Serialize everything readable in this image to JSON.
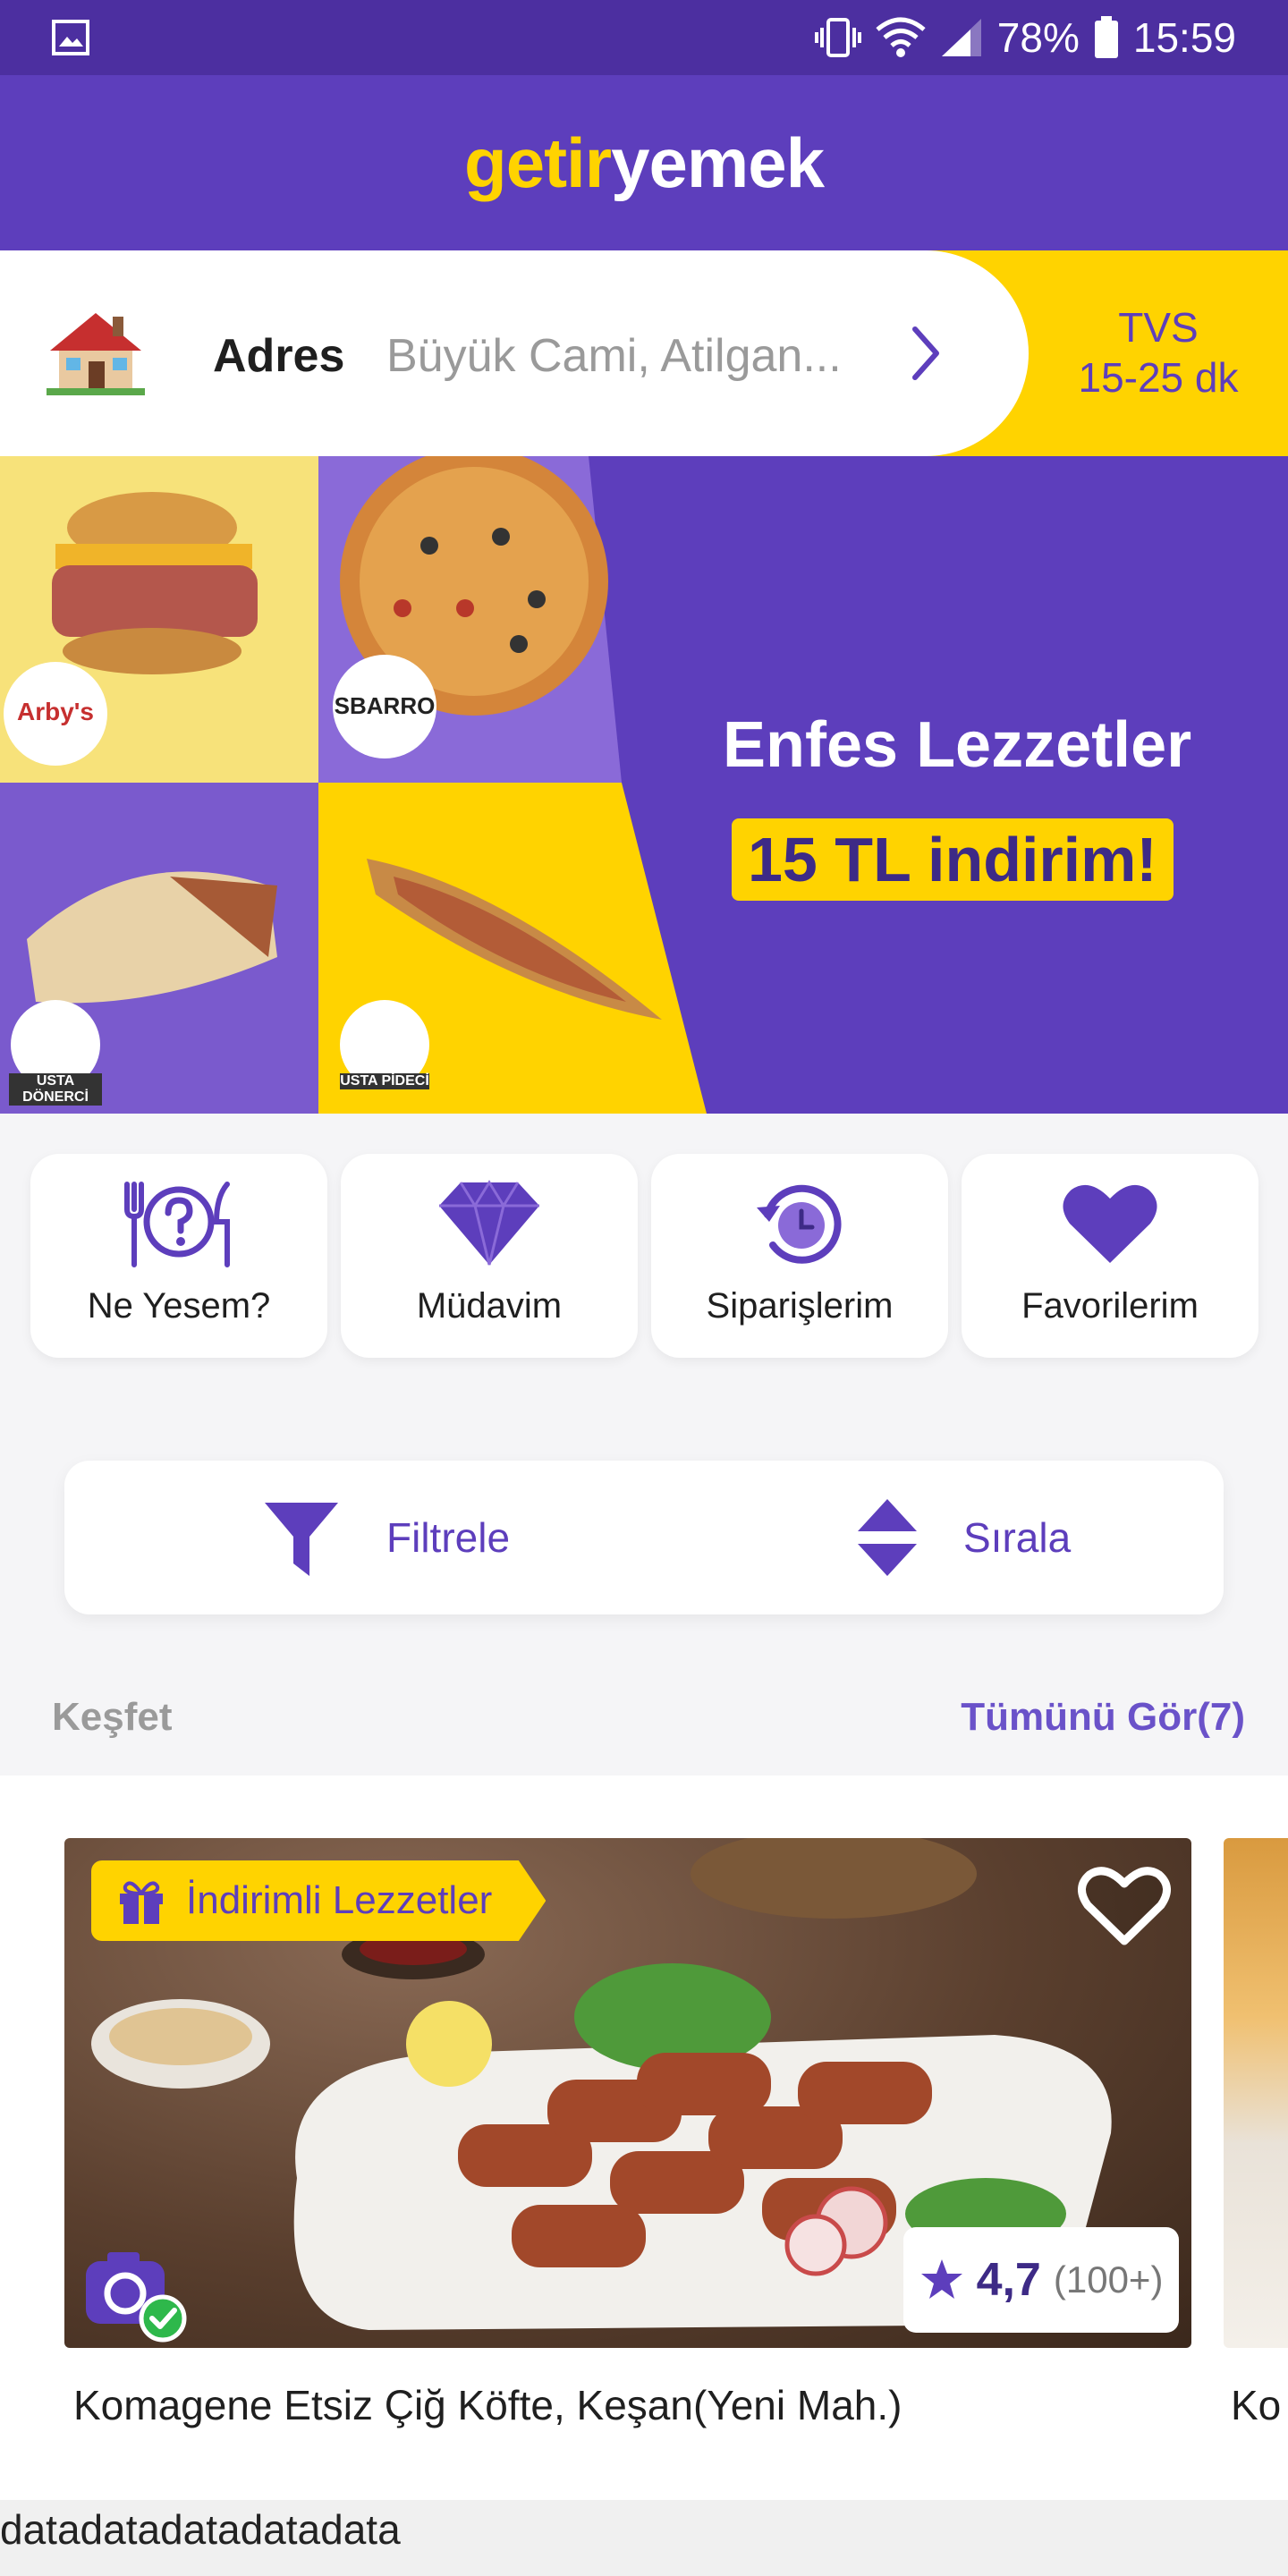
{
  "status_bar": {
    "battery": "78%",
    "time": "15:59"
  },
  "header": {
    "logo_part1": "getir",
    "logo_part2": "yemek"
  },
  "address": {
    "label": "Adres",
    "value": "Büyük Cami, Atilgan...",
    "eta_place": "TVS",
    "eta_time": "15-25 dk"
  },
  "banner": {
    "title": "Enfes Lezzetler",
    "subtitle": "15 TL indirim!",
    "brands": [
      "Arby's",
      "SBARRO",
      "USTA DÖNERCİ",
      "USTA PİDECİ"
    ]
  },
  "shortcuts": [
    {
      "label": "Ne Yesem?",
      "icon": "question-cutlery-icon"
    },
    {
      "label": "Müdavim",
      "icon": "diamond-icon"
    },
    {
      "label": "Siparişlerim",
      "icon": "history-icon"
    },
    {
      "label": "Favorilerim",
      "icon": "heart-icon"
    }
  ],
  "filter_bar": {
    "filter_label": "Filtrele",
    "sort_label": "Sırala"
  },
  "discover": {
    "title": "Keşfet",
    "see_all": "Tümünü Gör(7)"
  },
  "restaurant": {
    "promo": "İndirimli Lezzetler",
    "name": "Komagene Etsiz Çiğ Köfte, Keşan(Yeni Mah.)",
    "rating": "4,7",
    "rating_count": "(100+)",
    "next_name_partial": "Ko"
  },
  "footer": {
    "text": "datadatadatadatadata"
  },
  "colors": {
    "brand_purple": "#5d3ebc",
    "brand_yellow": "#ffd300"
  }
}
